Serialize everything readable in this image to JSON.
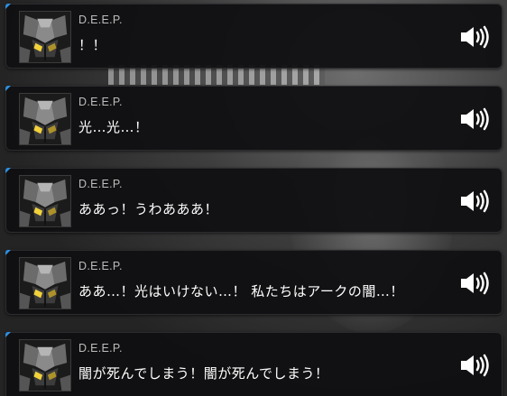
{
  "entries": [
    {
      "speaker": "D.E.E.P.",
      "text": "！！",
      "avatar": "deep-robot-icon",
      "voice": "speaker-icon"
    },
    {
      "speaker": "D.E.E.P.",
      "text": "光…光…！",
      "avatar": "deep-robot-icon",
      "voice": "speaker-icon"
    },
    {
      "speaker": "D.E.E.P.",
      "text": "ああっ！うわあああ！",
      "avatar": "deep-robot-icon",
      "voice": "speaker-icon"
    },
    {
      "speaker": "D.E.E.P.",
      "text": "ああ…！光はいけない…！ 私たちはアークの闇…！",
      "avatar": "deep-robot-icon",
      "voice": "speaker-icon"
    },
    {
      "speaker": "D.E.E.P.",
      "text": "闇が死んでしまう！闇が死んでしまう！",
      "avatar": "deep-robot-icon",
      "voice": "speaker-icon"
    }
  ],
  "colors": {
    "accent": "#2e8fe0",
    "panel": "#101012",
    "text": "#ffffff",
    "speaker": "#bdbdbd",
    "eye_glow": "#f2d23a"
  }
}
